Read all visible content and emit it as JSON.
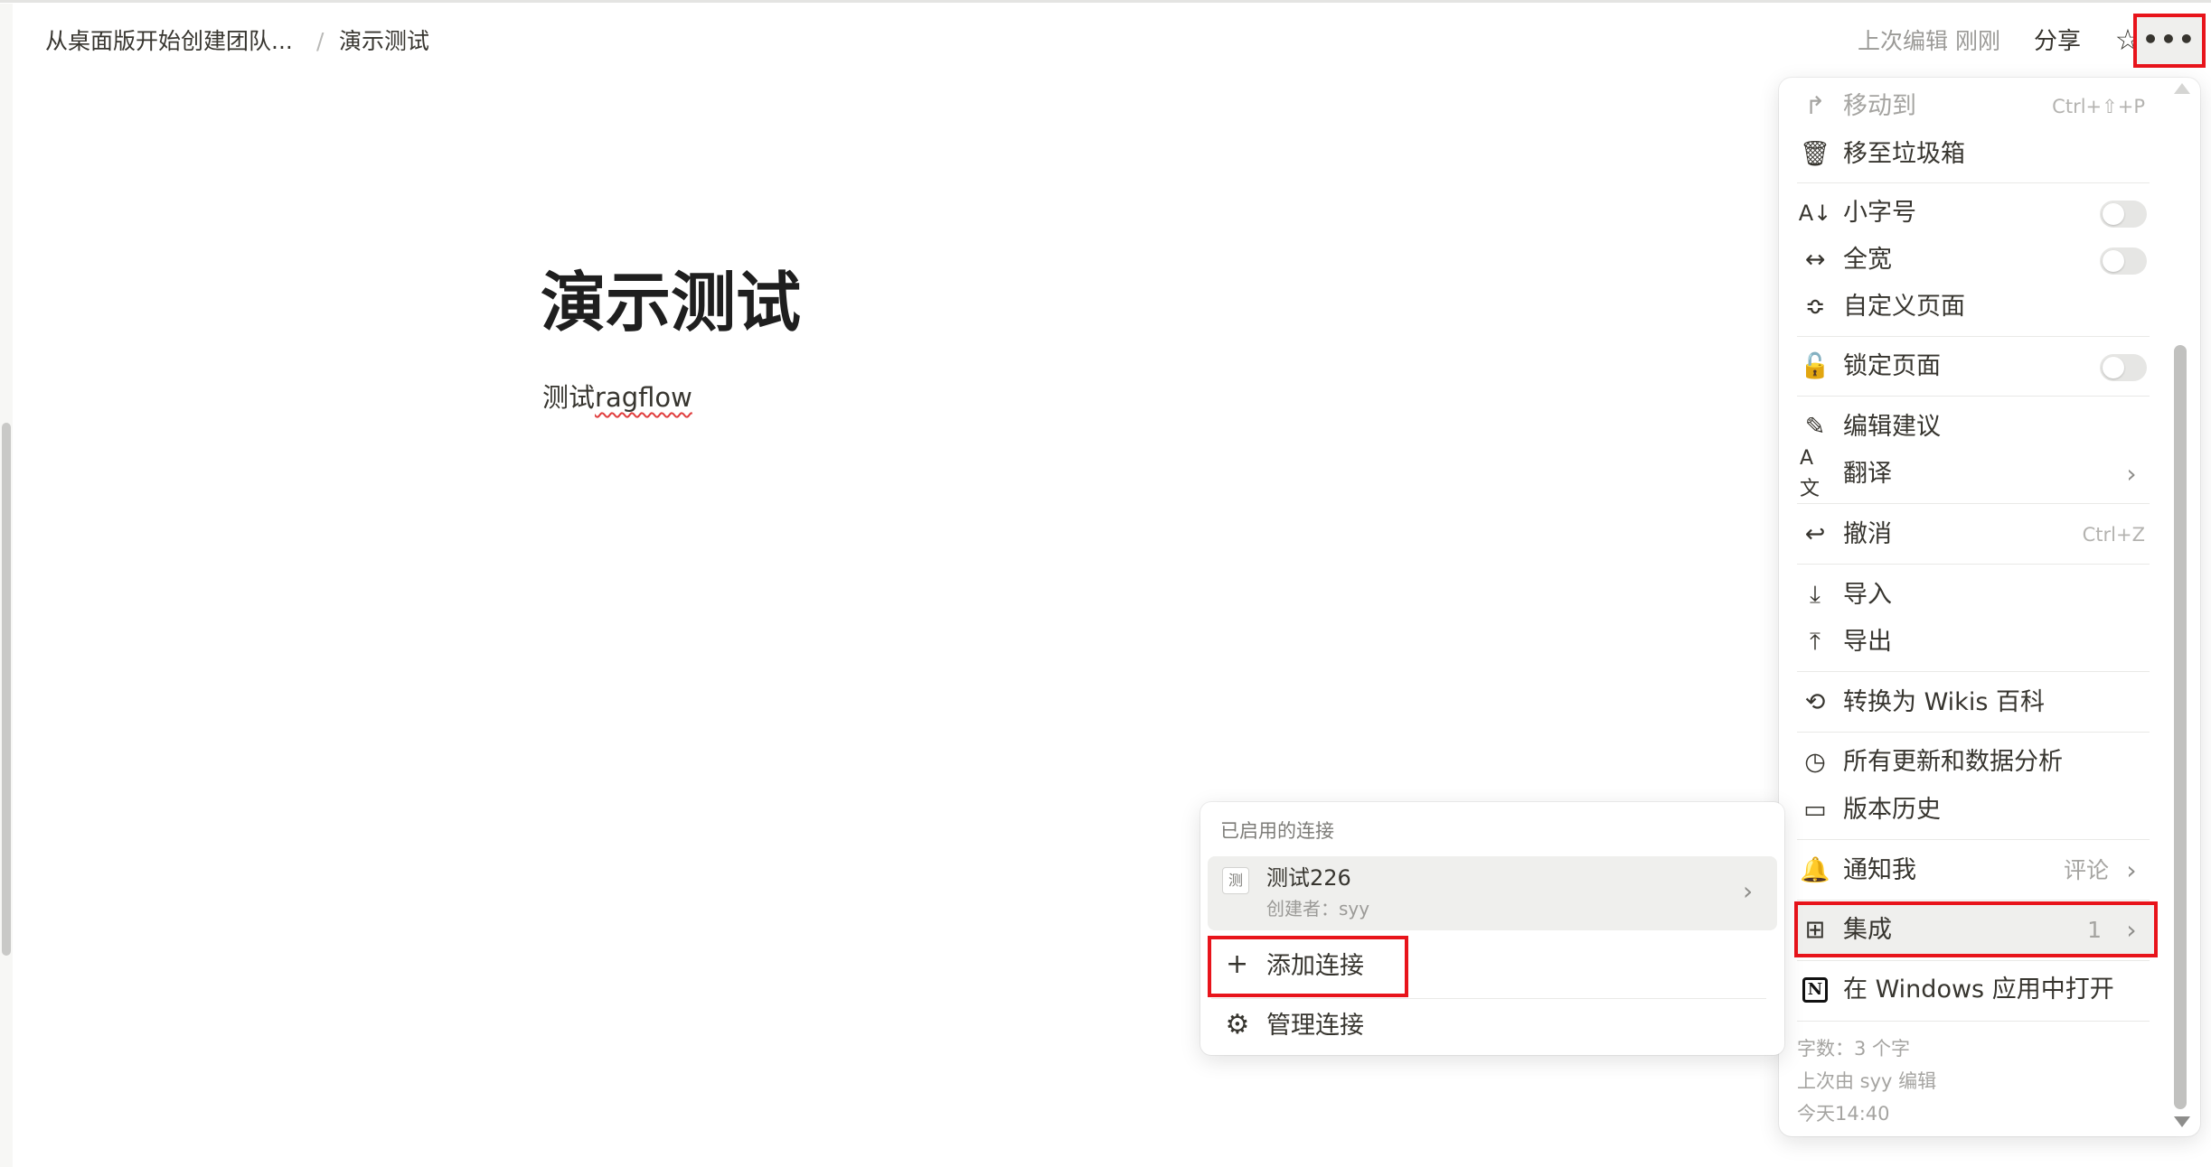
{
  "breadcrumb": {
    "parent": "从桌面版开始创建团队...",
    "separator": "/",
    "current": "演示测试"
  },
  "topbar": {
    "last_edited": "上次编辑 刚刚",
    "share_label": "分享",
    "star_icon": "star-icon",
    "more_label": "•••"
  },
  "page": {
    "title": "演示测试",
    "body_prefix": "测试",
    "body_misspelled": "ragflow"
  },
  "menu": {
    "move_to": {
      "label": "移动到",
      "shortcut": "Ctrl+⇧+P",
      "icon": "arrow-turn-right-icon"
    },
    "trash": {
      "label": "移至垃圾箱",
      "icon": "trash-icon"
    },
    "small_text": {
      "label": "小字号",
      "icon": "font-size-icon",
      "toggle": "off"
    },
    "full_width": {
      "label": "全宽",
      "icon": "arrows-horizontal-icon",
      "toggle": "off"
    },
    "customize": {
      "label": "自定义页面",
      "icon": "sliders-icon"
    },
    "lock": {
      "label": "锁定页面",
      "icon": "lock-open-icon",
      "toggle": "off"
    },
    "suggest": {
      "label": "编辑建议",
      "icon": "edit-suggest-icon"
    },
    "translate": {
      "label": "翻译",
      "icon": "translate-icon"
    },
    "undo": {
      "label": "撤消",
      "shortcut": "Ctrl+Z",
      "icon": "undo-icon"
    },
    "import": {
      "label": "导入",
      "icon": "import-icon"
    },
    "export": {
      "label": "导出",
      "icon": "export-icon"
    },
    "wiki": {
      "label": "转换为 Wikis 百科",
      "icon": "convert-icon"
    },
    "analytics": {
      "label": "所有更新和数据分析",
      "icon": "clock-icon"
    },
    "history": {
      "label": "版本历史",
      "icon": "history-icon"
    },
    "notify": {
      "label": "通知我",
      "value": "评论",
      "icon": "bell-icon"
    },
    "integrations": {
      "label": "集成",
      "value": "1",
      "icon": "grid-icon"
    },
    "open_windows": {
      "label": "在 Windows 应用中打开",
      "icon": "notion-icon",
      "icon_glyph": "N"
    },
    "footer": {
      "word_count": "字数：3 个字",
      "last_edited_by": "上次由 syy 编辑",
      "time": "今天14:40"
    }
  },
  "submenu": {
    "heading": "已启用的连接",
    "connection": {
      "avatar": "测",
      "name": "测试226",
      "creator": "创建者：syy"
    },
    "add_label": "添加连接",
    "manage_label": "管理连接"
  },
  "colors": {
    "highlight_border": "#e8141b",
    "text": "#37352f",
    "muted": "#a5a4a1",
    "hover_bg": "#efefed"
  }
}
